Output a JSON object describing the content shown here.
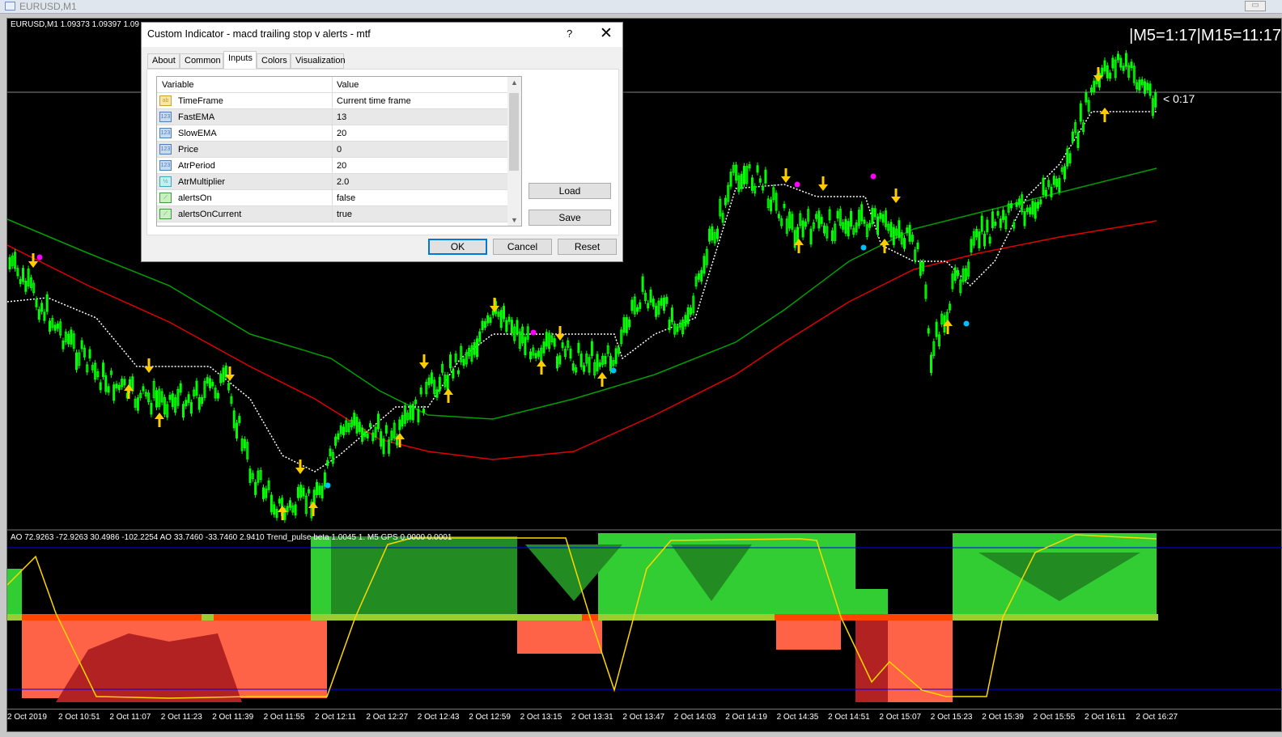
{
  "window": {
    "title": "EURUSD,M1"
  },
  "chart": {
    "symbol_info": "EURUSD,M1  1.09373 1.09397 1.09",
    "mtf_timer": "|M5=1:17|M15=11:17",
    "bar_countdown": "< 0:17",
    "oscillator_info": "AO 72.9263 -72.9263 30.4986   -102.2254  AO 33.7460 -33.7460 2.9410  Trend_pulse beta 1.0045 1.        M5 GPS 0.0000 0.0001",
    "time_labels": [
      "2 Oct 2019",
      "2 Oct 10:51",
      "2 Oct 11:07",
      "2 Oct 11:23",
      "2 Oct 11:39",
      "2 Oct 11:55",
      "2 Oct 12:11",
      "2 Oct 12:27",
      "2 Oct 12:43",
      "2 Oct 12:59",
      "2 Oct 13:15",
      "2 Oct 13:31",
      "2 Oct 13:47",
      "2 Oct 14:03",
      "2 Oct 14:19",
      "2 Oct 14:35",
      "2 Oct 14:51",
      "2 Oct 15:07",
      "2 Oct 15:23",
      "2 Oct 15:39",
      "2 Oct 15:55",
      "2 Oct 16:11",
      "2 Oct 16:27"
    ],
    "colors": {
      "candle": "#00ff00",
      "upper_band": "#00a000",
      "lower_band": "#e00000",
      "trail": "#ffffff",
      "arrow": "#ffcc00",
      "osc_up": "#32cd32",
      "osc_up_dark": "#228b22",
      "osc_down": "#ff6347",
      "osc_down_dark": "#b22222",
      "signal_line": "#ffd700",
      "level_line": "#0000ff"
    }
  },
  "dialog": {
    "title": "Custom Indicator - macd trailing stop v alerts - mtf",
    "help": "?",
    "close": "✕",
    "tabs": [
      "About",
      "Common",
      "Inputs",
      "Colors",
      "Visualization"
    ],
    "active_tab": "Inputs",
    "headers": {
      "variable": "Variable",
      "value": "Value"
    },
    "inputs": [
      {
        "icon": "ab",
        "variable": "TimeFrame",
        "value": "Current time frame"
      },
      {
        "icon": "123",
        "variable": "FastEMA",
        "value": "13"
      },
      {
        "icon": "123",
        "variable": "SlowEMA",
        "value": "20"
      },
      {
        "icon": "123",
        "variable": "Price",
        "value": "0"
      },
      {
        "icon": "123",
        "variable": "AtrPeriod",
        "value": "20"
      },
      {
        "icon": "½",
        "variable": "AtrMultiplier",
        "value": "2.0"
      },
      {
        "icon": "bool",
        "variable": "alertsOn",
        "value": "false"
      },
      {
        "icon": "bool",
        "variable": "alertsOnCurrent",
        "value": "true"
      }
    ],
    "buttons": {
      "load": "Load",
      "save": "Save",
      "ok": "OK",
      "cancel": "Cancel",
      "reset": "Reset"
    }
  }
}
